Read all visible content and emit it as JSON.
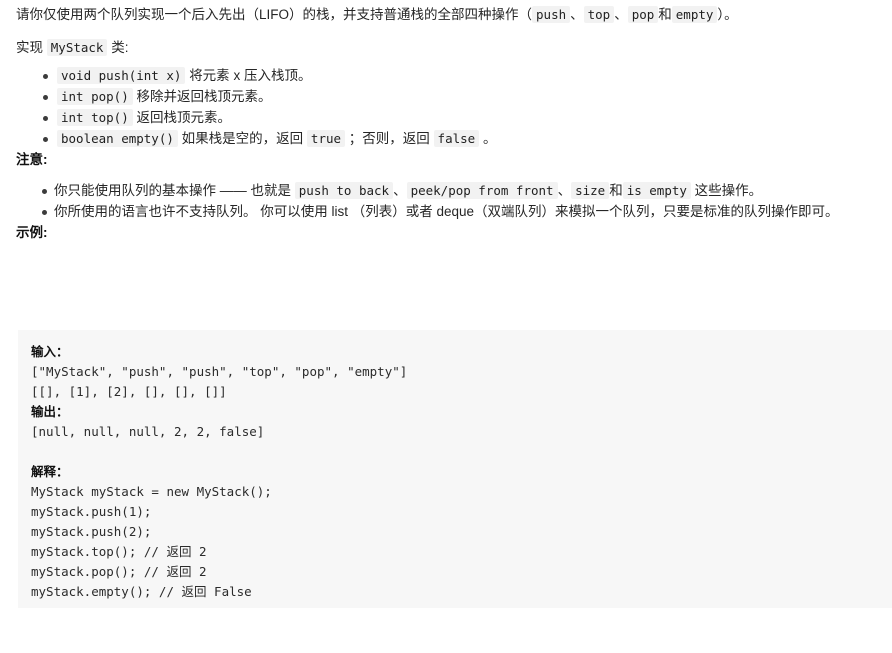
{
  "intro": {
    "before_lifo": "请你仅使用两个队列实现一个后入先出（LIFO）的栈，并支持普通栈的全部四种操作（",
    "op_push": "push",
    "sep1": "、",
    "op_top": "top",
    "sep2": "、",
    "op_pop": "pop",
    "sep3": "和",
    "op_empty": "empty",
    "after": "）。"
  },
  "implement": {
    "prefix": "实现 ",
    "class_name": "MyStack",
    "suffix": " 类:"
  },
  "methods": [
    {
      "signature": "void push(int x)",
      "description": "将元素 x 压入栈顶。"
    },
    {
      "signature": "int pop()",
      "description": "移除并返回栈顶元素。"
    },
    {
      "signature": "int top()",
      "description": "返回栈顶元素。"
    },
    {
      "signature": "boolean empty()",
      "desc_part1": "如果栈是空的，返回 ",
      "literal_true": "true",
      "desc_part2": " ；否则，返回 ",
      "literal_false": "false",
      "desc_part3": " 。"
    }
  ],
  "note": {
    "heading": "注意:",
    "item1": {
      "text_before": "你只能使用队列的基本操作 —— 也就是 ",
      "op1": "push to back",
      "sep1": "、",
      "op2": "peek/pop from front",
      "sep2": "、",
      "op3": "size",
      "sep3": "和",
      "op4": "is empty",
      "text_after": " 这些操作。"
    },
    "item2": "你所使用的语言也许不支持队列。 你可以使用 list （列表）或者 deque（双端队列）来模拟一个队列，只要是标准的队列操作即可。"
  },
  "example": {
    "heading": "示例:",
    "input_label": "输入：",
    "input_lines": [
      "[\"MyStack\", \"push\", \"push\", \"top\", \"pop\", \"empty\"]",
      "[[], [1], [2], [], [], []]"
    ],
    "output_label": "输出：",
    "output_lines": [
      "[null, null, null, 2, 2, false]"
    ],
    "explain_label": "解释：",
    "explain_lines": [
      "MyStack myStack = new MyStack();",
      "myStack.push(1);",
      "myStack.push(2);",
      "myStack.top(); // 返回 2",
      "myStack.pop(); // 返回 2",
      "myStack.empty(); // 返回 False"
    ]
  },
  "colors": {
    "code_block_bg": "#f7f7f7",
    "inline_code_bg": "#f2f2f2",
    "text": "#262626"
  }
}
